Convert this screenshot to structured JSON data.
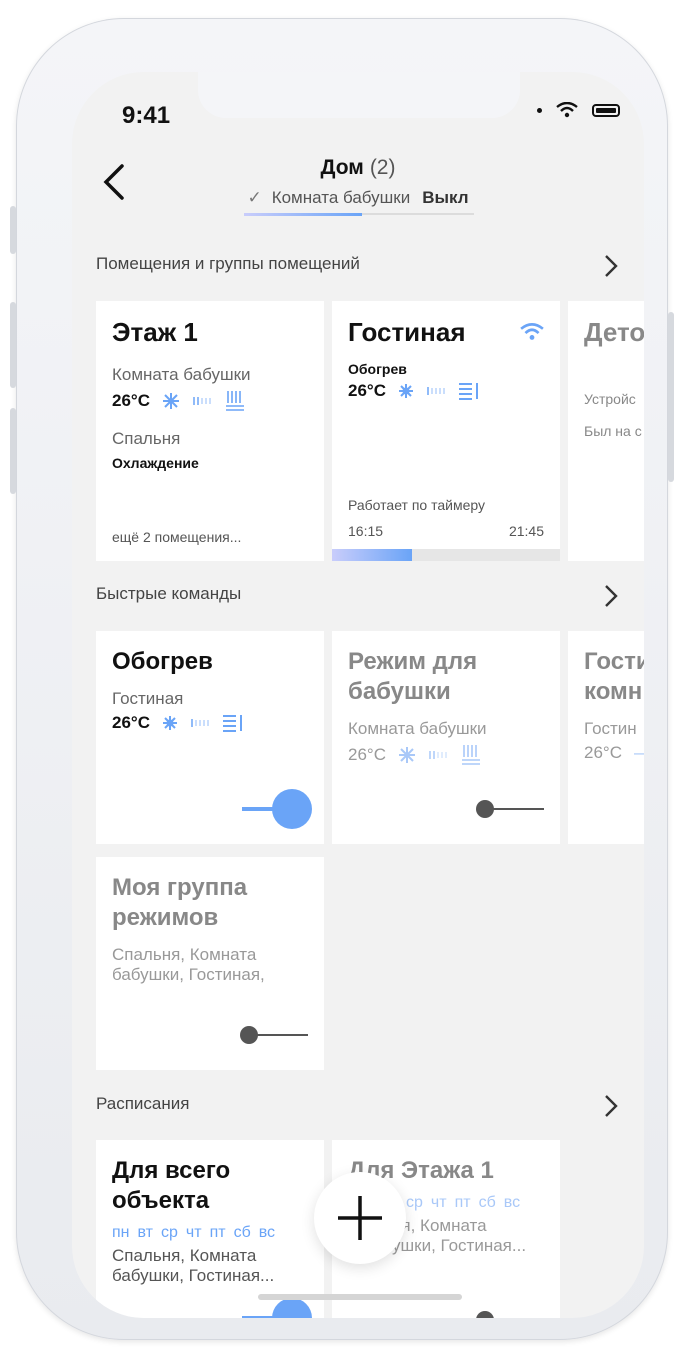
{
  "status": {
    "time": "9:41"
  },
  "header": {
    "title": "Дом",
    "count": "(2)",
    "room": "Комната бабушки",
    "state": "Выкл"
  },
  "sections": {
    "rooms": "Помещения и группы помещений",
    "commands": "Быстрые команды",
    "schedules": "Расписания"
  },
  "rooms": {
    "card1": {
      "title": "Этаж 1",
      "room1": "Комната бабушки",
      "temp1": "26°C",
      "room2": "Спальня",
      "mode2": "Охлаждение",
      "more": "ещё 2 помещения..."
    },
    "card2": {
      "title": "Гостиная",
      "mode": "Обогрев",
      "temp": "26°C",
      "timer_label": "Работает по таймеру",
      "start": "16:15",
      "end": "21:45",
      "timer_progress": 0.35
    },
    "card3": {
      "title": "Дето",
      "line1": "Устройс",
      "line2": "Был на с"
    }
  },
  "commands": {
    "card1": {
      "title": "Обогрев",
      "room": "Гостиная",
      "temp": "26°C",
      "enabled": true
    },
    "card2": {
      "title_line1": "Режим для",
      "title_line2": "бабушки",
      "room": "Комната бабушки",
      "temp": "26°C",
      "enabled": false
    },
    "card3": {
      "title_line1": "Гости",
      "title_line2": "комн",
      "room": "Гостин",
      "temp": "26°C"
    },
    "card4": {
      "title_line1": "Моя группа",
      "title_line2": "режимов",
      "rooms_line1": "Спальня, Комната",
      "rooms_line2": "бабушки, Гостиная,",
      "enabled": false
    }
  },
  "schedules": {
    "card1": {
      "title_line1": "Для всего",
      "title_line2": "объекта",
      "days": [
        "пн",
        "вт",
        "ср",
        "чт",
        "пт",
        "сб",
        "вс"
      ],
      "rooms_line1": "Спальня, Комната",
      "rooms_line2": "бабушки, Гостиная..."
    },
    "card2": {
      "title": "Для Этажа 1",
      "days": [
        "ср",
        "чт",
        "пт",
        "сб",
        "вс"
      ],
      "rooms_line1": "ня, Комната",
      "rooms_line2": "ушки, Гостиная..."
    }
  },
  "colors": {
    "accent": "#6aa4f7",
    "background": "#f2f2f2",
    "card": "#ffffff"
  },
  "icons": [
    "back-chevron-icon",
    "wifi-icon",
    "battery-icon",
    "snowflake-icon",
    "fan-speed-icon",
    "radiator-icon",
    "chevron-right-icon",
    "plus-icon"
  ]
}
